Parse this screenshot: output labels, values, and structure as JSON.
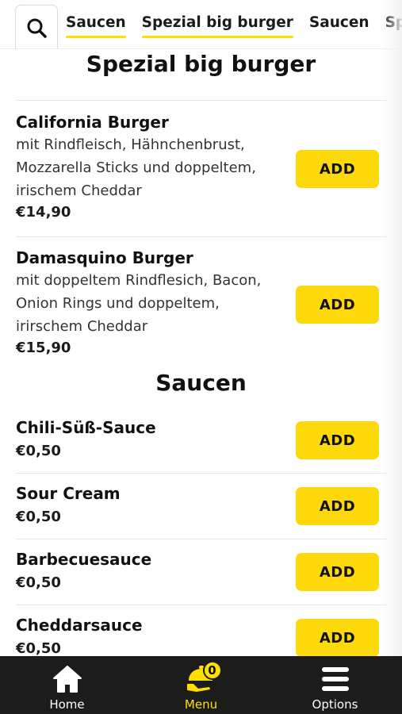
{
  "header": {
    "search_icon": "search-icon",
    "tabs": [
      {
        "label": "Saucen",
        "underlined": true
      },
      {
        "label": "Spezial big burger",
        "underlined": true
      },
      {
        "label": "Saucen",
        "underlined": false
      },
      {
        "label": "Spezial big burger",
        "underlined": false
      }
    ]
  },
  "sections": [
    {
      "title": "Spezial big burger",
      "items": [
        {
          "name": "California Burger",
          "description_lines": [
            "mit Rindfleisch, Hähnchenbrust,",
            "Mozzarella Sticks und doppeltem,",
            "irischem Cheddar"
          ],
          "price": "€14,90",
          "add_label": "ADD"
        },
        {
          "name": "Damasquino Burger",
          "description_lines": [
            "mit doppeltem Rindflesich, Bacon,",
            "Onion Rings und doppeltem,",
            "irirschem Cheddar"
          ],
          "price": "€15,90",
          "add_label": "ADD"
        }
      ]
    },
    {
      "title": "Saucen",
      "items": [
        {
          "name": "Chili-Süß-Sauce",
          "price": "€0,50",
          "add_label": "ADD"
        },
        {
          "name": "Sour Cream",
          "price": "€0,50",
          "add_label": "ADD"
        },
        {
          "name": "Barbecuesauce",
          "price": "€0,50",
          "add_label": "ADD"
        },
        {
          "name": "Cheddarsauce",
          "price": "€0,50",
          "add_label": "ADD"
        }
      ]
    }
  ],
  "bottom_nav": {
    "items": [
      {
        "label": "Home",
        "icon": "home-icon",
        "active": false
      },
      {
        "label": "Menu",
        "icon": "cloche-icon",
        "active": true,
        "badge": "0"
      },
      {
        "label": "Options",
        "icon": "hamburger-menu-icon",
        "active": false
      }
    ]
  },
  "colors": {
    "accent": "#fde000",
    "button": "#fdd90b",
    "nav_background": "#1c1c1c"
  }
}
